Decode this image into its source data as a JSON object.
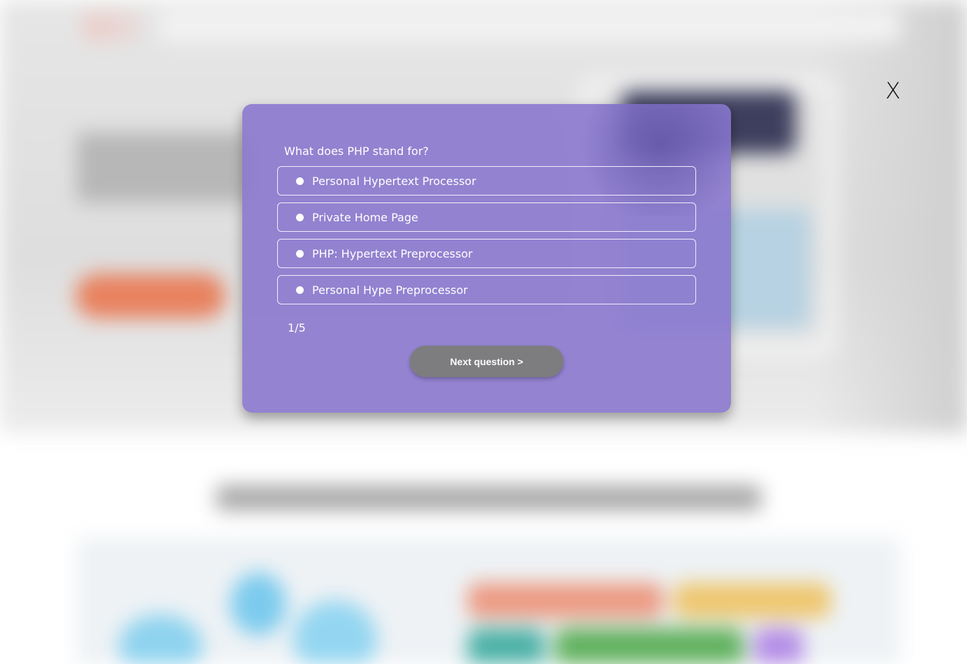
{
  "quiz": {
    "question": "What does PHP stand for?",
    "options": [
      {
        "label": "Personal Hypertext Processor"
      },
      {
        "label": "Private Home Page"
      },
      {
        "label": "PHP: Hypertext Preprocessor"
      },
      {
        "label": "Personal Hype Preprocessor"
      }
    ],
    "progress": "1/5",
    "next_button_label": "Next question >"
  },
  "close_button": {
    "label": "X"
  },
  "colors": {
    "modal_bg": "#8a78ce",
    "next_button_bg": "#7d7d80",
    "text": "#ffffff"
  }
}
